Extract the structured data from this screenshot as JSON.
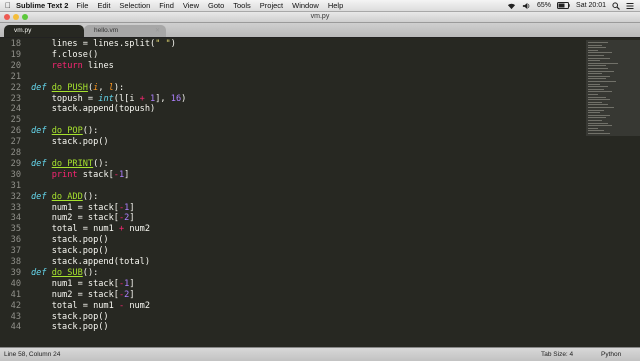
{
  "menubar": {
    "app_name": "Sublime Text 2",
    "menus": [
      "File",
      "Edit",
      "Selection",
      "Find",
      "View",
      "Goto",
      "Tools",
      "Project",
      "Window",
      "Help"
    ],
    "battery": "65%",
    "clock": "Sat 20:01"
  },
  "window": {
    "title": "vm.py"
  },
  "tabs": [
    {
      "label": "vm.py",
      "active": true
    },
    {
      "label": "hello.vm",
      "active": false
    }
  ],
  "editor": {
    "lines": [
      {
        "n": "18",
        "code": "    lines = lines.split(\" \")"
      },
      {
        "n": "19",
        "code": "    f.close()"
      },
      {
        "n": "20",
        "code": "    return lines"
      },
      {
        "n": "21",
        "code": ""
      },
      {
        "n": "22",
        "code": "def do_PUSH(i, l):"
      },
      {
        "n": "23",
        "code": "    topush = int(l[i + 1], 16)"
      },
      {
        "n": "24",
        "code": "    stack.append(topush)"
      },
      {
        "n": "25",
        "code": ""
      },
      {
        "n": "26",
        "code": "def do_POP():"
      },
      {
        "n": "27",
        "code": "    stack.pop()"
      },
      {
        "n": "28",
        "code": ""
      },
      {
        "n": "29",
        "code": "def do_PRINT():"
      },
      {
        "n": "30",
        "code": "    print stack[-1]"
      },
      {
        "n": "31",
        "code": ""
      },
      {
        "n": "32",
        "code": "def do_ADD():"
      },
      {
        "n": "33",
        "code": "    num1 = stack[-1]"
      },
      {
        "n": "34",
        "code": "    num2 = stack[-2]"
      },
      {
        "n": "35",
        "code": "    total = num1 + num2"
      },
      {
        "n": "36",
        "code": "    stack.pop()"
      },
      {
        "n": "37",
        "code": "    stack.pop()"
      },
      {
        "n": "38",
        "code": "    stack.append(total)"
      },
      {
        "n": "39",
        "code": "def do_SUB():"
      },
      {
        "n": "40",
        "code": "    num1 = stack[-1]"
      },
      {
        "n": "41",
        "code": "    num2 = stack[-2]"
      },
      {
        "n": "42",
        "code": "    total = num1 - num2"
      },
      {
        "n": "43",
        "code": "    stack.pop()"
      },
      {
        "n": "44",
        "code": "    stack.pop()"
      }
    ]
  },
  "statusbar": {
    "position": "Line 58, Column 24",
    "tab_size": "Tab Size: 4",
    "syntax": "Python"
  },
  "colors": {
    "background": "#272822",
    "keyword": "#f92672",
    "function": "#a6e22e",
    "parameter": "#fd971f",
    "number": "#ae81ff",
    "string": "#e6db74"
  },
  "icons": [
    "apple-icon",
    "wifi-icon",
    "volume-icon",
    "battery-icon",
    "search-icon",
    "list-icon",
    "close-traffic-light-icon",
    "minimize-traffic-light-icon",
    "zoom-traffic-light-icon",
    "tab-close-icon"
  ]
}
